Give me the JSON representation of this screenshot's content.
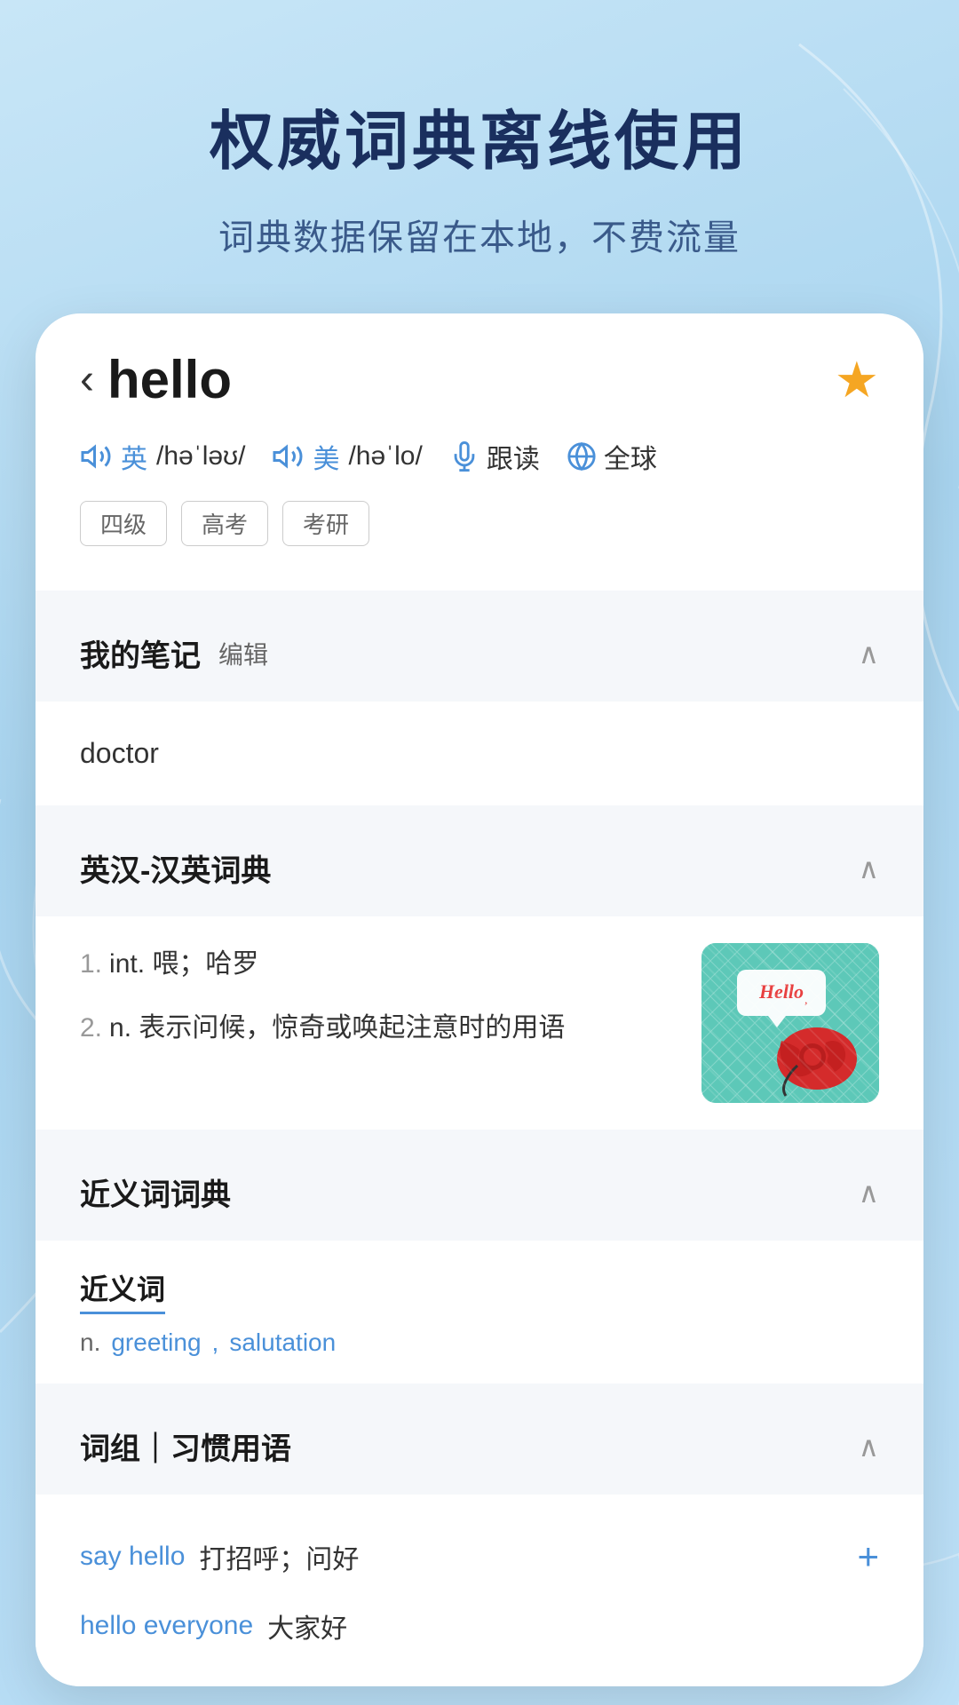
{
  "background": {
    "gradient_start": "#c8e6f7",
    "gradient_end": "#a8d4ef"
  },
  "header": {
    "main_title": "权威词典离线使用",
    "sub_title": "词典数据保留在本地，不费流量"
  },
  "word_card": {
    "back_symbol": "‹",
    "word": "hello",
    "star_filled": true,
    "pronunciations": [
      {
        "lang": "英",
        "phonetic": "/həˈləʊ/"
      },
      {
        "lang": "美",
        "phonetic": "/həˈlo/"
      }
    ],
    "functions": [
      {
        "label": "跟读"
      },
      {
        "label": "全球"
      }
    ],
    "tags": [
      "四级",
      "高考",
      "考研"
    ]
  },
  "notes_section": {
    "title": "我的笔记",
    "edit_label": "编辑",
    "note_content": "doctor",
    "collapsed": false
  },
  "dictionary_section": {
    "title": "英汉-汉英词典",
    "entries": [
      {
        "num": "1.",
        "pos": "int.",
        "definition": "喂；哈罗"
      },
      {
        "num": "2.",
        "pos": "n.",
        "definition": "表示问候，惊奇或唤起注意时的用语"
      }
    ]
  },
  "synonyms_section": {
    "title": "近义词词典",
    "group_label": "近义词",
    "pos": "n.",
    "synonyms": [
      "greeting",
      "salutation"
    ]
  },
  "phrases_section": {
    "title": "词组｜习惯用语",
    "phrases": [
      {
        "phrase": "say hello",
        "meaning": "打招呼；问好"
      },
      {
        "phrase": "hello everyone",
        "meaning": "大家好"
      }
    ]
  }
}
